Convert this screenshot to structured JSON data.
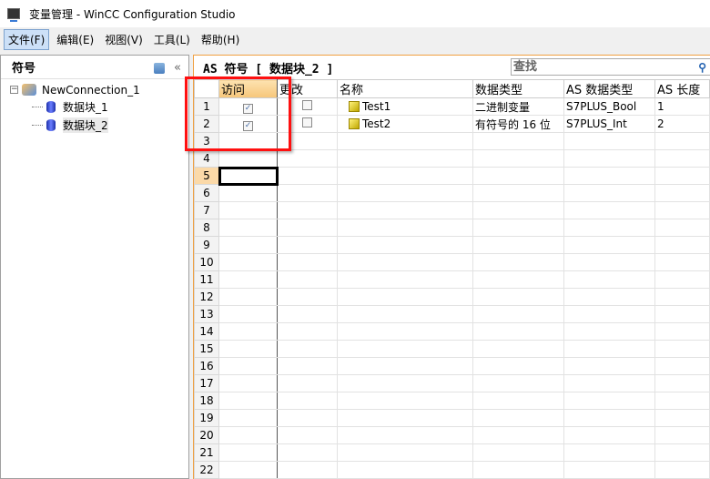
{
  "window": {
    "title": "变量管理 - WinCC Configuration Studio"
  },
  "menu": [
    {
      "label": "文件(F)"
    },
    {
      "label": "编辑(E)"
    },
    {
      "label": "视图(V)"
    },
    {
      "label": "工具(L)"
    },
    {
      "label": "帮助(H)"
    }
  ],
  "left": {
    "title": "符号",
    "collapse": "«",
    "tree": [
      {
        "label": "NewConnection_1"
      },
      {
        "label": "数据块_1"
      },
      {
        "label": "数据块_2"
      }
    ]
  },
  "right": {
    "title": "AS 符号 [ 数据块_2 ]",
    "search_placeholder": "查找",
    "columns": [
      "访问",
      "更改",
      "名称",
      "数据类型",
      "AS 数据类型",
      "AS 长度"
    ],
    "rows": [
      {
        "n": "1",
        "access": true,
        "change": false,
        "name": "Test1",
        "type": "二进制变量",
        "as_type": "S7PLUS_Bool",
        "as_len": "1"
      },
      {
        "n": "2",
        "access": true,
        "change": false,
        "name": "Test2",
        "type": "有符号的 16 位",
        "as_type": "S7PLUS_Int",
        "as_len": "2"
      }
    ],
    "row_numbers": [
      "3",
      "4",
      "5",
      "6",
      "7",
      "8",
      "9",
      "10",
      "11",
      "12",
      "13",
      "14",
      "15",
      "16",
      "17",
      "18",
      "19",
      "20",
      "21",
      "22"
    ]
  },
  "highlight_color": "#ff1010"
}
